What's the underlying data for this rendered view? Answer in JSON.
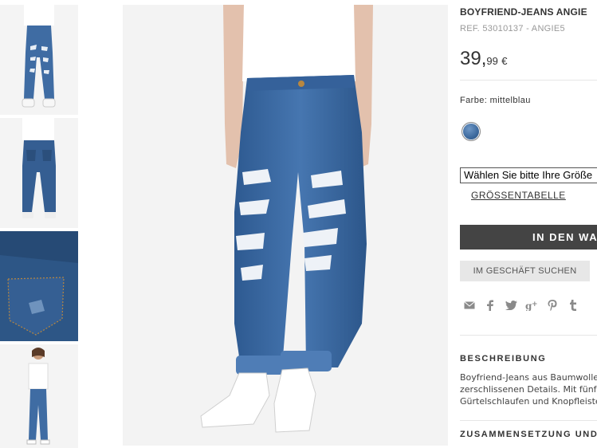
{
  "thumbnails": [
    {
      "alt": "front-view"
    },
    {
      "alt": "back-view"
    },
    {
      "alt": "pocket-detail"
    },
    {
      "alt": "full-body-view"
    }
  ],
  "product": {
    "title": "BOYFRIEND-JEANS ANGIE",
    "ref": "REF. 53010137 - ANGIE5",
    "price_int": "39,",
    "price_dec": "99",
    "price_currency": "€",
    "color_label": "Farbe: mittelblau",
    "swatch_color": "#3d6a9e",
    "size_select": "Wählen Sie bitte Ihre Größe",
    "size_table_link": "GRÖSSENTABELLE",
    "add_to_cart": "IN DEN WARENKORB",
    "find_in_store": "IM GESCHÄFT SUCHEN"
  },
  "share_icons": [
    "mail-icon",
    "facebook-icon",
    "twitter-icon",
    "googleplus-icon",
    "pinterest-icon",
    "tumblr-icon"
  ],
  "description": {
    "heading": "BESCHREIBUNG",
    "lines": [
      "Boyfriend-Jeans aus Baumwolle mit",
      "zerschlissenen Details. Mit fünf Taschen,",
      "Gürtelschlaufen und Knopfleiste."
    ]
  },
  "composition": {
    "heading": "ZUSAMMENSETZUNG UND PFLEGE"
  },
  "colors": {
    "denim": "#3a669e",
    "denim_dark": "#25466f",
    "cart_button": "#444444",
    "store_button": "#e7e7e7"
  }
}
